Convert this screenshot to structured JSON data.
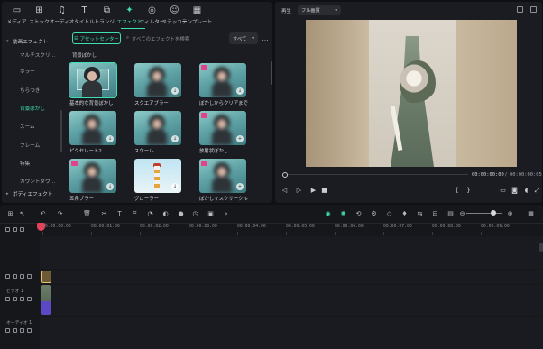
{
  "media_tabs": [
    {
      "label": "メディア",
      "icon": "media-icon",
      "glyph": "▭"
    },
    {
      "label": "ストック",
      "icon": "stock-icon",
      "glyph": "⊞"
    },
    {
      "label": "オーディオ",
      "icon": "audio-note-icon",
      "glyph": "♫"
    },
    {
      "label": "タイトル",
      "icon": "title-text-icon",
      "glyph": "T"
    },
    {
      "label": "トランジ…",
      "icon": "transition-icon",
      "glyph": "⧉"
    },
    {
      "label": "エフェクト",
      "icon": "effects-icon",
      "glyph": "✦"
    },
    {
      "label": "フィルター",
      "icon": "filter-icon",
      "glyph": "◎"
    },
    {
      "label": "ステッカー",
      "icon": "sticker-icon",
      "glyph": "☺"
    },
    {
      "label": "テンプレート",
      "icon": "template-icon",
      "glyph": "▦"
    }
  ],
  "active_tab": "エフェクト",
  "categories": [
    {
      "label": "動画エフェクト",
      "type": "parent"
    },
    {
      "label": "マルチスクリ…",
      "type": "child"
    },
    {
      "label": "ホラー",
      "type": "child"
    },
    {
      "label": "ちらつき",
      "type": "child"
    },
    {
      "label": "背景ぼかし",
      "type": "selected"
    },
    {
      "label": "ズーム",
      "type": "child"
    },
    {
      "label": "フレーム",
      "type": "child"
    },
    {
      "label": "特集",
      "type": "child"
    },
    {
      "label": "カウントダウ…",
      "type": "child"
    },
    {
      "label": "ボディエフェクト",
      "type": "parent"
    }
  ],
  "browser": {
    "asset_center_label": "アセットセンター",
    "search_placeholder": "すべてのエフェクトを検索",
    "filter_value": "すべて",
    "more_label": "…",
    "section_title": "背景ぼかし"
  },
  "effects": [
    {
      "label": "基本的な背景ぼかし",
      "selected": true,
      "pro": false,
      "download": false,
      "style": "frame"
    },
    {
      "label": "スクエアブラー",
      "selected": false,
      "pro": false,
      "download": true,
      "style": "blur"
    },
    {
      "label": "ぼかしからクリアまで",
      "selected": false,
      "pro": true,
      "download": true,
      "style": "blur"
    },
    {
      "label": "ピクセレート2",
      "selected": false,
      "pro": false,
      "download": true,
      "style": "blur"
    },
    {
      "label": "スケール",
      "selected": false,
      "pro": false,
      "download": true,
      "style": "blur"
    },
    {
      "label": "放射状ぼかし",
      "selected": false,
      "pro": true,
      "download": true,
      "style": "blur-add"
    },
    {
      "label": "五角ブラー",
      "selected": false,
      "pro": true,
      "download": true,
      "style": "blur"
    },
    {
      "label": "グローラー",
      "selected": false,
      "pro": false,
      "download": true,
      "style": "lighthouse"
    },
    {
      "label": "ぼかしマスクサークル",
      "selected": false,
      "pro": true,
      "download": true,
      "style": "blur-add"
    }
  ],
  "preview": {
    "label": "再生",
    "quality": "フル画質",
    "time_current": "00:00:00:00",
    "time_separator": "/",
    "time_total": "00:00:00:05",
    "progress": 0,
    "controls": [
      {
        "name": "prev-frame-icon",
        "glyph": "◁"
      },
      {
        "name": "next-frame-icon",
        "glyph": "▷"
      },
      {
        "name": "play-icon",
        "glyph": "▶"
      },
      {
        "name": "stop-icon",
        "glyph": "■"
      },
      {
        "name": "mark-in-icon",
        "glyph": "{"
      },
      {
        "name": "mark-out-icon",
        "glyph": "}"
      },
      {
        "name": "monitor-icon",
        "glyph": "▭"
      },
      {
        "name": "snapshot-icon",
        "glyph": "◙"
      },
      {
        "name": "volume-icon",
        "glyph": "◖"
      },
      {
        "name": "fullscreen-icon",
        "glyph": "⤢"
      }
    ]
  },
  "timeline": {
    "toolbar_left": [
      {
        "name": "layout-icon",
        "glyph": "⊞"
      },
      {
        "name": "select-icon",
        "glyph": "↖"
      },
      {
        "name": "undo-icon",
        "glyph": "↶"
      },
      {
        "name": "redo-icon",
        "glyph": "↷"
      },
      {
        "name": "delete-icon",
        "glyph": "🗑"
      },
      {
        "name": "cut-icon",
        "glyph": "✂"
      },
      {
        "name": "text-icon",
        "glyph": "T"
      },
      {
        "name": "crop-icon",
        "glyph": "⌗"
      },
      {
        "name": "speed-icon",
        "glyph": "◔"
      },
      {
        "name": "color-icon",
        "glyph": "◐"
      },
      {
        "name": "record-icon",
        "glyph": "●"
      },
      {
        "name": "timer-icon",
        "glyph": "◷"
      },
      {
        "name": "fit-icon",
        "glyph": "▣"
      },
      {
        "name": "more-tools-icon",
        "glyph": "»"
      }
    ],
    "toolbar_right": [
      {
        "name": "render-icon",
        "glyph": "◉",
        "green": true
      },
      {
        "name": "shield-icon",
        "glyph": "✺",
        "green": true
      },
      {
        "name": "auto-icon",
        "glyph": "⟲",
        "green": false
      },
      {
        "name": "ai-icon",
        "glyph": "⚙",
        "green": false
      },
      {
        "name": "marker-icon",
        "glyph": "◇",
        "green": false
      },
      {
        "name": "mic-icon",
        "glyph": "♦",
        "green": false
      },
      {
        "name": "split-icon",
        "glyph": "⇆",
        "green": false
      },
      {
        "name": "grid-icon",
        "glyph": "⊟",
        "green": false
      },
      {
        "name": "subtitle-icon",
        "glyph": "▤",
        "green": false
      },
      {
        "name": "zoom-out-icon",
        "glyph": "⊖",
        "green": false
      },
      {
        "name": "zoom-in-icon",
        "glyph": "⊕",
        "green": false
      },
      {
        "name": "timeline-grid-icon",
        "glyph": "▦",
        "green": false
      }
    ],
    "ruler_ticks": [
      "00:00:00:00",
      "00:00:01:00",
      "00:00:02:00",
      "00:00:03:00",
      "00:00:04:00",
      "00:00:05:00",
      "00:00:06:00",
      "00:00:07:00",
      "00:00:08:00",
      "00:00:09:00"
    ],
    "tracks": [
      {
        "name": "",
        "kind": "effect"
      },
      {
        "name": "ビデオ 1",
        "kind": "video"
      },
      {
        "name": "オーディオ 1",
        "kind": "audio"
      }
    ]
  }
}
